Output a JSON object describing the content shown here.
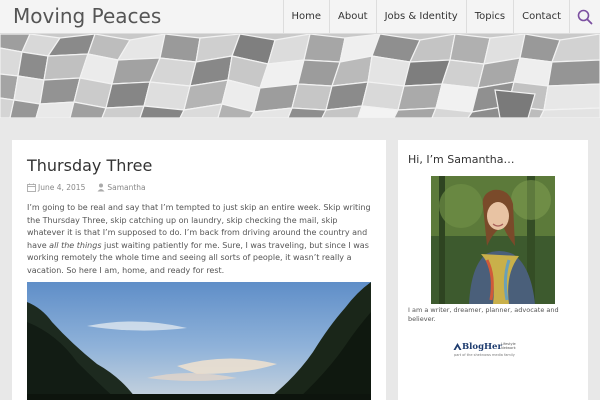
{
  "site": {
    "title": "Moving Peaces"
  },
  "nav": {
    "items": [
      "Home",
      "About",
      "Jobs & Identity",
      "Topics",
      "Contact"
    ],
    "search_icon": "search-icon"
  },
  "post": {
    "title": "Thursday Three",
    "date": "June 4, 2015",
    "author": "Samantha",
    "body_1": "I’m going to be real and say that I’m tempted to just skip an entire week. Skip writing the Thursday Three, skip catching up on laundry, skip checking the mail, skip whatever it is that I’m supposed to do. I’m back from driving around the country and have ",
    "body_em": "all the things",
    "body_2": " just waiting patiently for me. Sure, I was traveling, but since I was working remotely the whole time and seeing all sorts of people, it wasn’t really a vacation. So here I am, home, and ready for rest."
  },
  "sidebar": {
    "title": "Hi, I’m Samantha…",
    "bio": "I am a writer, dreamer, planner, advocate and believer.",
    "badge": {
      "name": "BlogHer",
      "tagline": "Lifestyle Network",
      "sub": "part of the sheknows media family"
    }
  },
  "colors": {
    "accent": "#7b4fa0",
    "background": "#e8e8e8",
    "card": "#ffffff"
  }
}
